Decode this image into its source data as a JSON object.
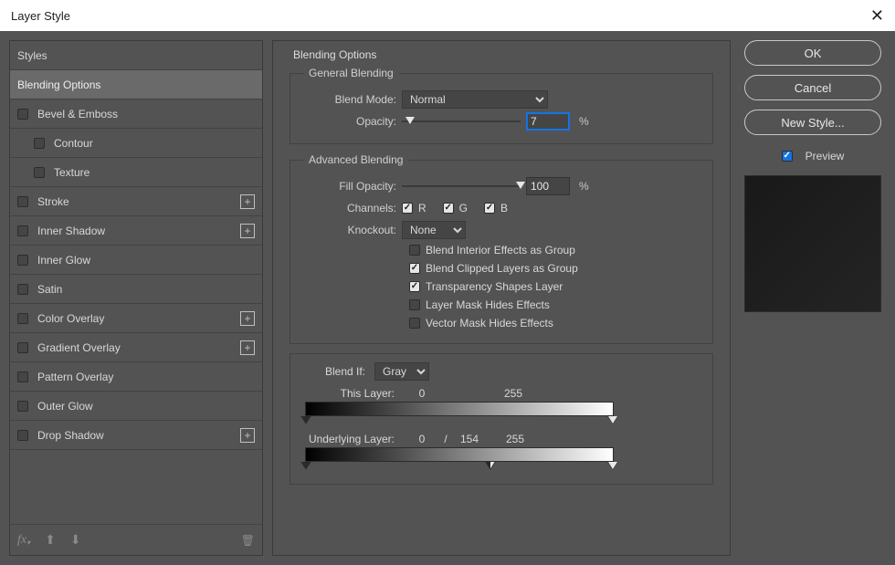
{
  "title": "Layer Style",
  "sidebar": {
    "header": "Styles",
    "items": [
      {
        "label": "Blending Options",
        "selected": true,
        "checkbox": false,
        "sub": false,
        "add": false
      },
      {
        "label": "Bevel & Emboss",
        "selected": false,
        "checkbox": true,
        "sub": false,
        "add": false
      },
      {
        "label": "Contour",
        "selected": false,
        "checkbox": true,
        "sub": true,
        "add": false
      },
      {
        "label": "Texture",
        "selected": false,
        "checkbox": true,
        "sub": true,
        "add": false
      },
      {
        "label": "Stroke",
        "selected": false,
        "checkbox": true,
        "sub": false,
        "add": true
      },
      {
        "label": "Inner Shadow",
        "selected": false,
        "checkbox": true,
        "sub": false,
        "add": true
      },
      {
        "label": "Inner Glow",
        "selected": false,
        "checkbox": true,
        "sub": false,
        "add": false
      },
      {
        "label": "Satin",
        "selected": false,
        "checkbox": true,
        "sub": false,
        "add": false
      },
      {
        "label": "Color Overlay",
        "selected": false,
        "checkbox": true,
        "sub": false,
        "add": true
      },
      {
        "label": "Gradient Overlay",
        "selected": false,
        "checkbox": true,
        "sub": false,
        "add": true
      },
      {
        "label": "Pattern Overlay",
        "selected": false,
        "checkbox": true,
        "sub": false,
        "add": false
      },
      {
        "label": "Outer Glow",
        "selected": false,
        "checkbox": true,
        "sub": false,
        "add": false
      },
      {
        "label": "Drop Shadow",
        "selected": false,
        "checkbox": true,
        "sub": false,
        "add": true
      }
    ]
  },
  "options": {
    "title": "Blending Options",
    "general": {
      "legend": "General Blending",
      "blend_mode_label": "Blend Mode:",
      "blend_mode_value": "Normal",
      "opacity_label": "Opacity:",
      "opacity_value": "7",
      "opacity_slider_pct": 7,
      "opacity_unit": "%"
    },
    "advanced": {
      "legend": "Advanced Blending",
      "fill_opacity_label": "Fill Opacity:",
      "fill_opacity_value": "100",
      "fill_opacity_slider_pct": 100,
      "fill_opacity_unit": "%",
      "channels_label": "Channels:",
      "channels": {
        "r": "R",
        "g": "G",
        "b": "B",
        "r_on": true,
        "g_on": true,
        "b_on": true
      },
      "knockout_label": "Knockout:",
      "knockout_value": "None",
      "cks": [
        {
          "label": "Blend Interior Effects as Group",
          "on": false
        },
        {
          "label": "Blend Clipped Layers as Group",
          "on": true
        },
        {
          "label": "Transparency Shapes Layer",
          "on": true
        },
        {
          "label": "Layer Mask Hides Effects",
          "on": false
        },
        {
          "label": "Vector Mask Hides Effects",
          "on": false
        }
      ]
    },
    "blendif": {
      "label": "Blend If:",
      "value": "Gray",
      "this_label": "This Layer:",
      "this_vals": {
        "lo": "0",
        "hi": "255"
      },
      "under_label": "Underlying Layer:",
      "under_vals": {
        "lo": "0",
        "midsep": "/",
        "mid": "154",
        "hi": "255"
      }
    }
  },
  "right": {
    "ok": "OK",
    "cancel": "Cancel",
    "newstyle": "New Style...",
    "preview_label": "Preview",
    "preview_on": true
  }
}
